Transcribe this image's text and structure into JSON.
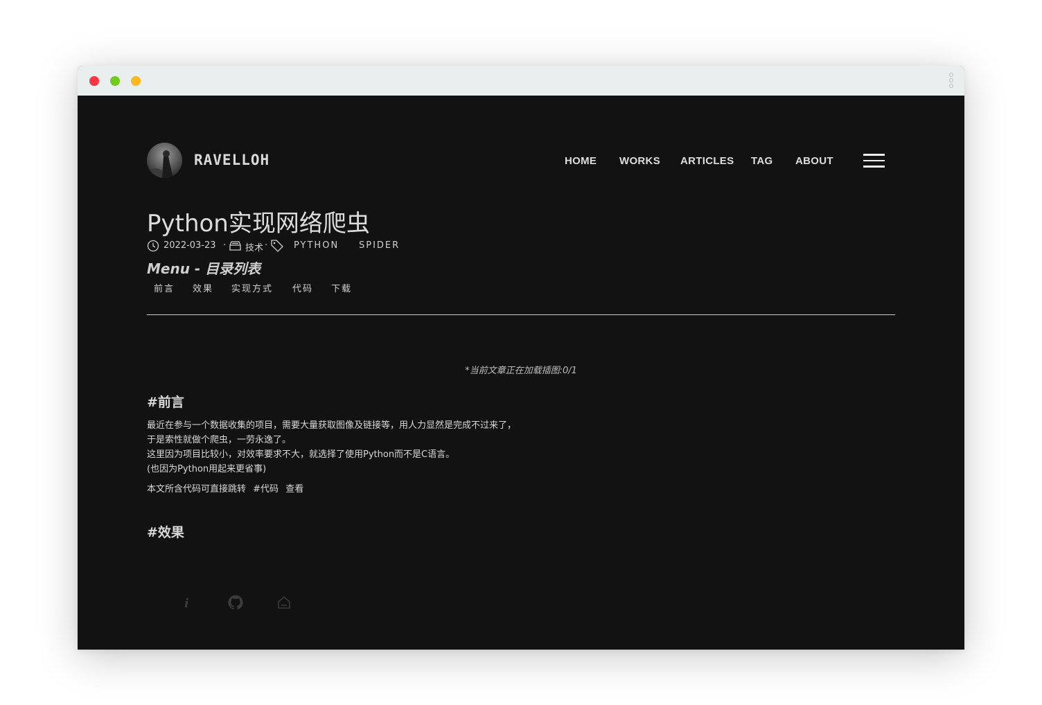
{
  "header": {
    "brand": "RAVELLOH",
    "nav": [
      {
        "label": "HOME"
      },
      {
        "label": "WORKS"
      },
      {
        "label": "ARTICLES"
      },
      {
        "label": "TAG"
      },
      {
        "label": "ABOUT"
      }
    ]
  },
  "post": {
    "title": "Python实现网络爬虫",
    "date": "2022-03-23",
    "category": "技术",
    "tags": [
      "PYTHON",
      "SPIDER"
    ]
  },
  "menu": {
    "title": "Menu - 目录列表",
    "items": [
      "前言",
      "效果",
      "实现方式",
      "代码",
      "下载"
    ]
  },
  "loading_text": "*当前文章正在加载插图:0/1",
  "sections": {
    "preface_heading": "#前言",
    "preface_lines": [
      "最近在参与一个数据收集的项目，需要大量获取图像及链接等，用人力显然是完成不过来了，",
      "于是索性就做个爬虫，一劳永逸了。",
      "这里因为项目比较小，对效率要求不大，就选择了使用Python而不是C语言。",
      "(也因为Python用起来更省事)"
    ],
    "jump_text": "本文所含代码可直接跳转",
    "jump_link": "#代码",
    "jump_view": "查看",
    "effect_heading": "#效果"
  },
  "footer_icons": [
    "info-icon",
    "github-icon",
    "home-icon"
  ],
  "colors": {
    "background": "#121212",
    "titlebar": "#e9efee",
    "close": "#fb3640",
    "minimize": "#74c91f",
    "maximize": "#fdb81b"
  }
}
